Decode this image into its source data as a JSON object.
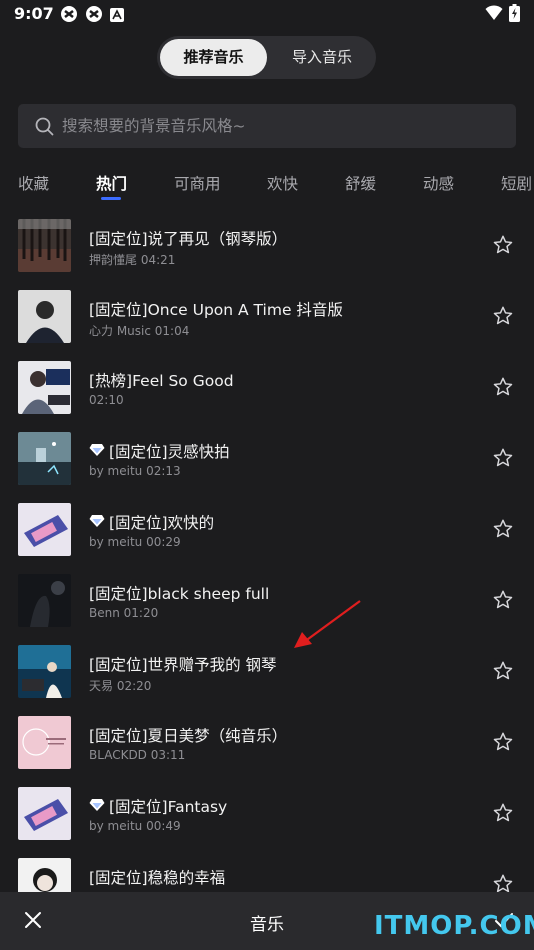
{
  "status": {
    "time": "9:07"
  },
  "segment": {
    "active": "推荐音乐",
    "inactive": "导入音乐"
  },
  "search": {
    "placeholder": "搜索想要的背景音乐风格~"
  },
  "tabs": [
    "收藏",
    "热门",
    "可商用",
    "欢快",
    "舒缓",
    "动感",
    "短剧"
  ],
  "active_tab": "热门",
  "tracks": [
    {
      "title": "[固定位]说了再见（钢琴版）",
      "subtitle": "押韵懂尾 04:21",
      "vip": false
    },
    {
      "title": "[固定位]Once Upon A Time 抖音版",
      "subtitle": "心力 Music 01:04",
      "vip": false
    },
    {
      "title": "[热榜]Feel So Good",
      "subtitle": "02:10",
      "vip": false
    },
    {
      "title": "[固定位]灵感快拍",
      "subtitle": "by meitu 02:13",
      "vip": true
    },
    {
      "title": "[固定位]欢快的",
      "subtitle": "by meitu 00:29",
      "vip": true
    },
    {
      "title": "[固定位]black sheep full",
      "subtitle": "Benn 01:20",
      "vip": false
    },
    {
      "title": "[固定位]世界赠予我的 钢琴",
      "subtitle": "天易 02:20",
      "vip": false
    },
    {
      "title": "[固定位]夏日美梦（纯音乐）",
      "subtitle": "BLACKDD 03:11",
      "vip": false
    },
    {
      "title": "[固定位]Fantasy",
      "subtitle": "by meitu 00:49",
      "vip": true
    },
    {
      "title": "[固定位]稳稳的幸福",
      "subtitle": "",
      "vip": false
    }
  ],
  "bottom": {
    "title": "音乐"
  },
  "watermark": "ITMOP.COM",
  "colors": {
    "accent": "#3c6cff",
    "background": "#1c1c1e",
    "annotation_arrow": "#e01e1e",
    "watermark": "#44c8ee"
  }
}
